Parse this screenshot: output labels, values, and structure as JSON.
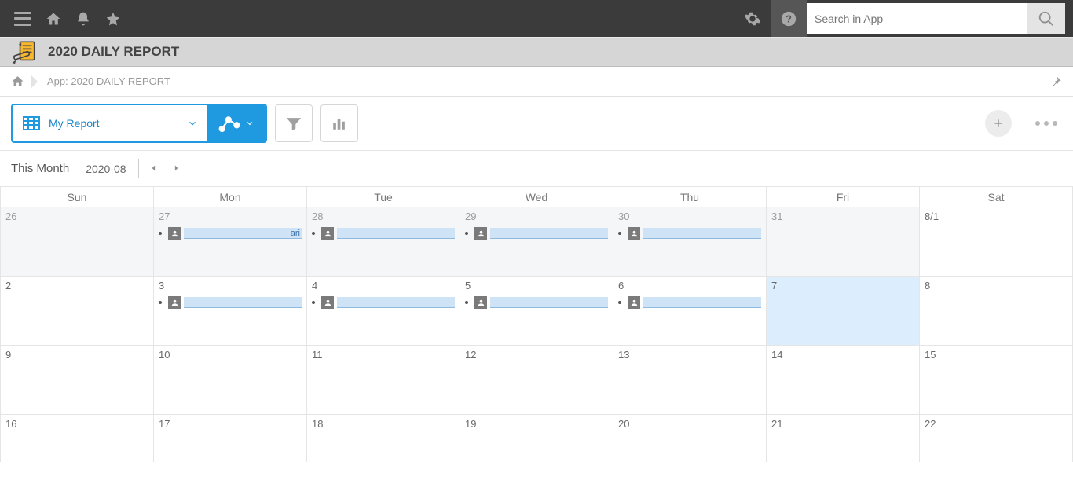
{
  "topbar": {
    "search_placeholder": "Search in App"
  },
  "app": {
    "title": "2020 DAILY REPORT"
  },
  "breadcrumb": {
    "label": "App: 2020 DAILY REPORT"
  },
  "toolbar": {
    "view_label": "My Report"
  },
  "monthbar": {
    "label": "This Month",
    "value": "2020-08"
  },
  "calendar": {
    "day_headers": [
      "Sun",
      "Mon",
      "Tue",
      "Wed",
      "Thu",
      "Fri",
      "Sat"
    ],
    "weeks": [
      [
        {
          "n": "26",
          "prev": true
        },
        {
          "n": "27",
          "prev": true,
          "event": true,
          "tail": "ari"
        },
        {
          "n": "28",
          "prev": true,
          "event": true,
          "tail": ""
        },
        {
          "n": "29",
          "prev": true,
          "event": true,
          "tail": ""
        },
        {
          "n": "30",
          "prev": true,
          "event": true,
          "tail": ""
        },
        {
          "n": "31",
          "prev": true
        },
        {
          "n": "8/1"
        }
      ],
      [
        {
          "n": "2"
        },
        {
          "n": "3",
          "event": true,
          "tail": ""
        },
        {
          "n": "4",
          "event": true,
          "tail": ""
        },
        {
          "n": "5",
          "event": true,
          "tail": ""
        },
        {
          "n": "6",
          "event": true,
          "tail": ""
        },
        {
          "n": "7",
          "today": true
        },
        {
          "n": "8"
        }
      ],
      [
        {
          "n": "9"
        },
        {
          "n": "10"
        },
        {
          "n": "11"
        },
        {
          "n": "12"
        },
        {
          "n": "13"
        },
        {
          "n": "14"
        },
        {
          "n": "15"
        }
      ],
      [
        {
          "n": "16"
        },
        {
          "n": "17"
        },
        {
          "n": "18"
        },
        {
          "n": "19"
        },
        {
          "n": "20"
        },
        {
          "n": "21"
        },
        {
          "n": "22"
        }
      ]
    ]
  }
}
